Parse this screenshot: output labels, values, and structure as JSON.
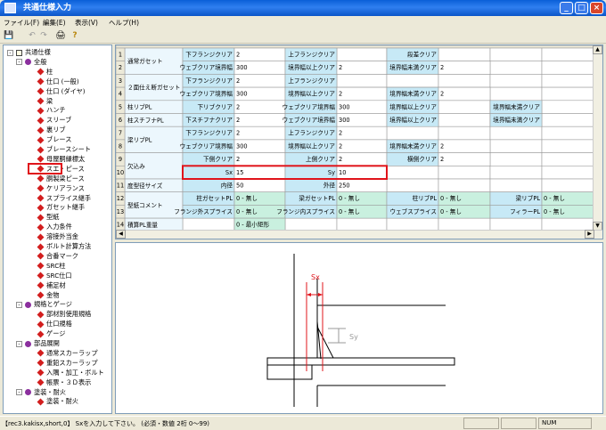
{
  "window": {
    "title": "共通仕様入力",
    "minimize": "_",
    "maximize": "□",
    "close": "×"
  },
  "menu": [
    "ファイル(F)",
    "編集(E)",
    "表示(V)",
    "ヘルプ(H)"
  ],
  "toolbar": {
    "save": "💾",
    "undo": "↶",
    "redo": "↷",
    "print": "🖨",
    "help": "?"
  },
  "tree": [
    {
      "t": "共通仕様",
      "lv": 0,
      "icon": "root",
      "exp": "-"
    },
    {
      "t": "全般",
      "lv": 1,
      "icon": "folder",
      "exp": "-"
    },
    {
      "t": "柱",
      "lv": 2,
      "icon": "red"
    },
    {
      "t": "仕口 (一般)",
      "lv": 2,
      "icon": "red"
    },
    {
      "t": "仕口 (ダイヤ)",
      "lv": 2,
      "icon": "red"
    },
    {
      "t": "梁",
      "lv": 2,
      "icon": "red"
    },
    {
      "t": "ハンチ",
      "lv": 2,
      "icon": "red"
    },
    {
      "t": "スリーブ",
      "lv": 2,
      "icon": "red"
    },
    {
      "t": "裏リブ",
      "lv": 2,
      "icon": "red"
    },
    {
      "t": "ブレース",
      "lv": 2,
      "icon": "red"
    },
    {
      "t": "ブレースシート",
      "lv": 2,
      "icon": "red"
    },
    {
      "t": "母屋胴縁標太",
      "lv": 2,
      "icon": "red"
    },
    {
      "t": "スエ・ピース",
      "lv": 2,
      "icon": "red"
    },
    {
      "t": "胴製梁ピース",
      "lv": 2,
      "icon": "red"
    },
    {
      "t": "ケリアランス",
      "lv": 2,
      "icon": "red"
    },
    {
      "t": "スプライス継手",
      "lv": 2,
      "icon": "red"
    },
    {
      "t": "ガセット継手",
      "lv": 2,
      "icon": "red"
    },
    {
      "t": "型紙",
      "lv": 2,
      "icon": "red"
    },
    {
      "t": "入力条件",
      "lv": 2,
      "icon": "red"
    },
    {
      "t": "溶接外当金",
      "lv": 2,
      "icon": "red"
    },
    {
      "t": "ボルト計算方法",
      "lv": 2,
      "icon": "red"
    },
    {
      "t": "合番マーク",
      "lv": 2,
      "icon": "red"
    },
    {
      "t": "SRC柱",
      "lv": 2,
      "icon": "red"
    },
    {
      "t": "SRC仕口",
      "lv": 2,
      "icon": "red"
    },
    {
      "t": "補足材",
      "lv": 2,
      "icon": "red"
    },
    {
      "t": "金物",
      "lv": 2,
      "icon": "red"
    },
    {
      "t": "規格とゲージ",
      "lv": 1,
      "icon": "folder",
      "exp": "-"
    },
    {
      "t": "部材別使用規格",
      "lv": 2,
      "icon": "red"
    },
    {
      "t": "仕口規格",
      "lv": 2,
      "icon": "red"
    },
    {
      "t": "ゲージ",
      "lv": 2,
      "icon": "red"
    },
    {
      "t": "部品展開",
      "lv": 1,
      "icon": "folder",
      "exp": "-"
    },
    {
      "t": "通常スカーラップ",
      "lv": 2,
      "icon": "red"
    },
    {
      "t": "重鉛スカーラップ",
      "lv": 2,
      "icon": "red"
    },
    {
      "t": "入隅・加工・ボルト",
      "lv": 2,
      "icon": "red"
    },
    {
      "t": "帳票・３Ｄ表示",
      "lv": 2,
      "icon": "red"
    },
    {
      "t": "塗装・耐火",
      "lv": 1,
      "icon": "folder",
      "exp": "-"
    },
    {
      "t": "塗装・耐火",
      "lv": 2,
      "icon": "red"
    }
  ],
  "grid": {
    "row_headers": [
      "1",
      "2",
      "3",
      "4",
      "5",
      "6",
      "7",
      "8",
      "9",
      "10",
      "11",
      "12",
      "13",
      "14"
    ],
    "groups": [
      {
        "t": "通常ガセット",
        "r": [
          1,
          2
        ]
      },
      {
        "t": "２面仕え断ガセット",
        "r": [
          3,
          4
        ]
      },
      {
        "t": "柱リブPL",
        "r": [
          5,
          5
        ]
      },
      {
        "t": "柱スチフナPL",
        "r": [
          6,
          6
        ]
      },
      {
        "t": "梁リブPL",
        "r": [
          7,
          8
        ]
      },
      {
        "t": "欠込み",
        "r": [
          9,
          10
        ]
      },
      {
        "t": "度型径サイズ",
        "r": [
          11,
          11
        ]
      },
      {
        "t": "型紙コメント",
        "r": [
          12,
          13
        ]
      },
      {
        "t": "積算PL重量",
        "r": [
          14,
          14
        ]
      }
    ],
    "cells": [
      {
        "r": 1,
        "c": 1,
        "t": "下フランジクリア",
        "k": "l"
      },
      {
        "r": 1,
        "c": 2,
        "t": "2"
      },
      {
        "r": 1,
        "c": 3,
        "t": "上フランジクリア",
        "k": "l"
      },
      {
        "r": 1,
        "c": 5,
        "t": "段差クリア",
        "k": "l"
      },
      {
        "r": 2,
        "c": 1,
        "t": "ウェブクリア境界幅",
        "k": "l"
      },
      {
        "r": 2,
        "c": 2,
        "t": "300"
      },
      {
        "r": 2,
        "c": 3,
        "t": "境界幅以上クリア",
        "k": "l"
      },
      {
        "r": 2,
        "c": 4,
        "t": "2"
      },
      {
        "r": 2,
        "c": 5,
        "t": "境界幅未満クリア",
        "k": "l"
      },
      {
        "r": 2,
        "c": 6,
        "t": "2"
      },
      {
        "r": 3,
        "c": 1,
        "t": "下フランジクリア",
        "k": "l"
      },
      {
        "r": 3,
        "c": 2,
        "t": "2"
      },
      {
        "r": 3,
        "c": 3,
        "t": "上フランジクリア",
        "k": "l"
      },
      {
        "r": 4,
        "c": 1,
        "t": "ウェブクリア境界幅",
        "k": "l"
      },
      {
        "r": 4,
        "c": 2,
        "t": "300"
      },
      {
        "r": 4,
        "c": 3,
        "t": "境界幅以上クリア",
        "k": "l"
      },
      {
        "r": 4,
        "c": 4,
        "t": "2"
      },
      {
        "r": 4,
        "c": 5,
        "t": "境界幅未満クリア",
        "k": "l"
      },
      {
        "r": 4,
        "c": 6,
        "t": "2"
      },
      {
        "r": 5,
        "c": 1,
        "t": "下リブクリア",
        "k": "l"
      },
      {
        "r": 5,
        "c": 2,
        "t": "2"
      },
      {
        "r": 5,
        "c": 3,
        "t": "ウェブクリア境界幅",
        "k": "l"
      },
      {
        "r": 5,
        "c": 4,
        "t": "300"
      },
      {
        "r": 5,
        "c": 5,
        "t": "境界幅以上クリア",
        "k": "l"
      },
      {
        "r": 5,
        "c": 7,
        "t": "境界幅未満クリア",
        "k": "l"
      },
      {
        "r": 6,
        "c": 1,
        "t": "下スチフナクリア",
        "k": "l"
      },
      {
        "r": 6,
        "c": 2,
        "t": "2"
      },
      {
        "r": 6,
        "c": 3,
        "t": "ウェブクリア境界幅",
        "k": "l"
      },
      {
        "r": 6,
        "c": 4,
        "t": "300"
      },
      {
        "r": 6,
        "c": 5,
        "t": "境界幅以上クリア",
        "k": "l"
      },
      {
        "r": 6,
        "c": 7,
        "t": "境界幅未満クリア",
        "k": "l"
      },
      {
        "r": 7,
        "c": 1,
        "t": "下フランジクリア",
        "k": "l"
      },
      {
        "r": 7,
        "c": 2,
        "t": "2"
      },
      {
        "r": 7,
        "c": 3,
        "t": "上フランジクリア",
        "k": "l"
      },
      {
        "r": 7,
        "c": 4,
        "t": "2"
      },
      {
        "r": 8,
        "c": 1,
        "t": "ウェブクリア境界幅",
        "k": "l"
      },
      {
        "r": 8,
        "c": 2,
        "t": "300"
      },
      {
        "r": 8,
        "c": 3,
        "t": "境界幅以上クリア",
        "k": "l"
      },
      {
        "r": 8,
        "c": 4,
        "t": "2"
      },
      {
        "r": 8,
        "c": 5,
        "t": "境界幅未満クリア",
        "k": "l"
      },
      {
        "r": 8,
        "c": 6,
        "t": "2"
      },
      {
        "r": 9,
        "c": 1,
        "t": "下側クリア",
        "k": "l"
      },
      {
        "r": 9,
        "c": 2,
        "t": "2"
      },
      {
        "r": 9,
        "c": 3,
        "t": "上側クリア",
        "k": "l"
      },
      {
        "r": 9,
        "c": 4,
        "t": "2"
      },
      {
        "r": 9,
        "c": 5,
        "t": "横側クリア",
        "k": "l"
      },
      {
        "r": 9,
        "c": 6,
        "t": "2"
      },
      {
        "r": 10,
        "c": 1,
        "t": "Sx",
        "k": "l"
      },
      {
        "r": 10,
        "c": 2,
        "t": "15"
      },
      {
        "r": 10,
        "c": 3,
        "t": "Sy",
        "k": "l"
      },
      {
        "r": 10,
        "c": 4,
        "t": "10"
      },
      {
        "r": 11,
        "c": 1,
        "t": "内径",
        "k": "l"
      },
      {
        "r": 11,
        "c": 2,
        "t": "50"
      },
      {
        "r": 11,
        "c": 3,
        "t": "外径",
        "k": "l"
      },
      {
        "r": 11,
        "c": 4,
        "t": "250"
      },
      {
        "r": 12,
        "c": 1,
        "t": "柱ガセットPL",
        "k": "l"
      },
      {
        "r": 12,
        "c": 2,
        "t": "0 - 無し",
        "k": "g"
      },
      {
        "r": 12,
        "c": 3,
        "t": "梁ガセットPL",
        "k": "l"
      },
      {
        "r": 12,
        "c": 4,
        "t": "0 - 無し",
        "k": "g"
      },
      {
        "r": 12,
        "c": 5,
        "t": "柱リブPL",
        "k": "l"
      },
      {
        "r": 12,
        "c": 6,
        "t": "0 - 無し",
        "k": "g"
      },
      {
        "r": 12,
        "c": 7,
        "t": "梁リブPL",
        "k": "l"
      },
      {
        "r": 12,
        "c": 8,
        "t": "0 - 無し",
        "k": "g"
      },
      {
        "r": 13,
        "c": 1,
        "t": "フランジ外スプライス",
        "k": "l"
      },
      {
        "r": 13,
        "c": 2,
        "t": "0 - 無し",
        "k": "g"
      },
      {
        "r": 13,
        "c": 3,
        "t": "フランジ内スプライス",
        "k": "l"
      },
      {
        "r": 13,
        "c": 4,
        "t": "0 - 無し",
        "k": "g"
      },
      {
        "r": 13,
        "c": 5,
        "t": "ウェブスプライス",
        "k": "l"
      },
      {
        "r": 13,
        "c": 6,
        "t": "0 - 無し",
        "k": "g"
      },
      {
        "r": 13,
        "c": 7,
        "t": "フィラーPL",
        "k": "l"
      },
      {
        "r": 13,
        "c": 8,
        "t": "0 - 無し",
        "k": "g"
      },
      {
        "r": 14,
        "c": 2,
        "t": "0 - 最小矩形",
        "k": "g"
      }
    ]
  },
  "drawing": {
    "sx_label": "Sx",
    "sy_label": "Sy"
  },
  "status": {
    "message": "【rec3.kakisx,short,0】 Sxを入力して下さい。 (必須・数値 2桁 0～99)",
    "num": "NUM"
  },
  "colors": {
    "header_bg": "#ecf7fd",
    "label_bg": "#c7e9f6",
    "combo_bg": "#c9f0df",
    "highlight": "#e0141b"
  }
}
